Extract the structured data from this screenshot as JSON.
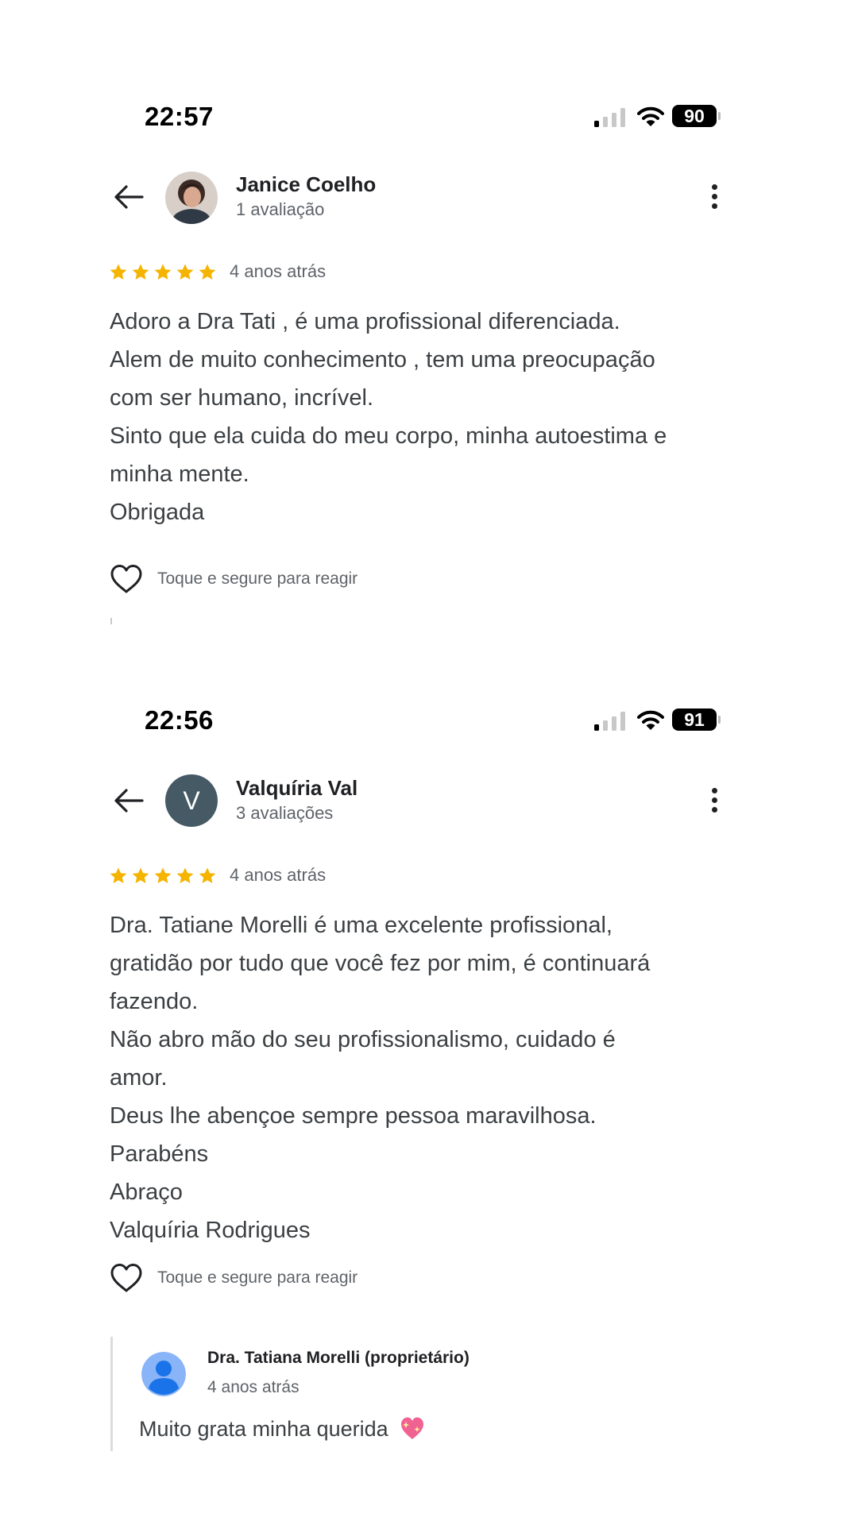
{
  "screens": [
    {
      "status_bar": {
        "time": "22:57",
        "battery": "90"
      },
      "reviewer": {
        "name": "Janice Coelho",
        "review_count": "1 avaliação"
      },
      "review": {
        "rating": 5,
        "date": "4 anos atrás",
        "lines": [
          "Adoro a Dra Tati , é uma profissional diferenciada.",
          "Alem de muito conhecimento , tem uma preocupação",
          "com ser humano, incrível.",
          "Sinto que ela cuida do meu corpo, minha autoestima e",
          "minha mente.",
          "Obrigada"
        ]
      },
      "react_label": "Toque e segure para reagir"
    },
    {
      "status_bar": {
        "time": "22:56",
        "battery": "91"
      },
      "reviewer": {
        "name": "Valquíria Val",
        "review_count": "3 avaliações",
        "avatar_letter": "V"
      },
      "review": {
        "rating": 5,
        "date": "4 anos atrás",
        "lines": [
          "Dra. Tatiane Morelli é uma excelente profissional,",
          "gratidão por tudo que você fez por mim, é continuará",
          "fazendo.",
          "Não abro mão do seu profissionalismo, cuidado é",
          "amor.",
          "Deus lhe abençoe sempre pessoa maravilhosa.",
          "Parabéns",
          "Abraço",
          "Valquíria Rodrigues"
        ]
      },
      "react_label": "Toque e segure para reagir",
      "owner_reply": {
        "name": "Dra. Tatiana Morelli (proprietário)",
        "date": "4 anos atrás",
        "text": "Muito grata minha querida"
      }
    }
  ],
  "colors": {
    "star": "#f5b400",
    "text_primary": "#202124",
    "text_secondary": "#5f6368",
    "avatar_letter_bg": "#455a64",
    "owner_avatar_bg": "#4285f4"
  }
}
